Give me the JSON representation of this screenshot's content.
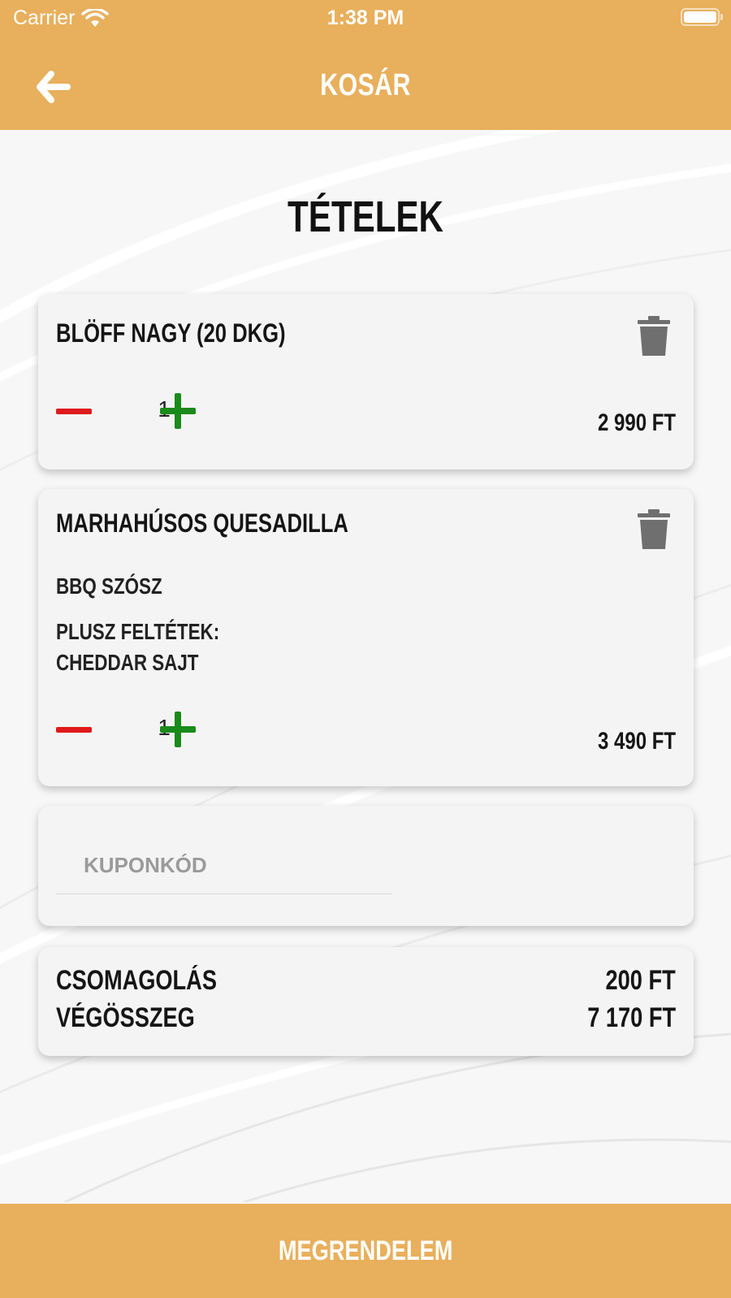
{
  "status_bar": {
    "carrier": "Carrier",
    "time": "1:38 PM"
  },
  "nav": {
    "title": "KOSÁR",
    "back_icon": "arrow-left-icon"
  },
  "page": {
    "section_title": "TÉTELEK"
  },
  "cart_items": [
    {
      "name": "BLÖFF NAGY (20 DKG)",
      "details": [],
      "quantity": "1",
      "price": "2 990 FT"
    },
    {
      "name": "MARHAHÚSOS QUESADILLA",
      "details": [
        "BBQ SZÓSZ",
        "PLUSZ FELTÉTEK:",
        "CHEDDAR SAJT"
      ],
      "quantity": "1",
      "price": "3 490 FT"
    }
  ],
  "coupon": {
    "placeholder": "KUPONKÓD",
    "value": ""
  },
  "summary": {
    "packaging_label": "CSOMAGOLÁS",
    "packaging_value": "200 FT",
    "total_label": "VÉGÖSSZEG",
    "total_value": "7 170 FT"
  },
  "order_button": {
    "label": "MEGRENDELEM"
  },
  "colors": {
    "accent": "#e8af5c",
    "minus": "#e0191c",
    "plus": "#1a8a1a",
    "trash": "#6f6f6f"
  }
}
